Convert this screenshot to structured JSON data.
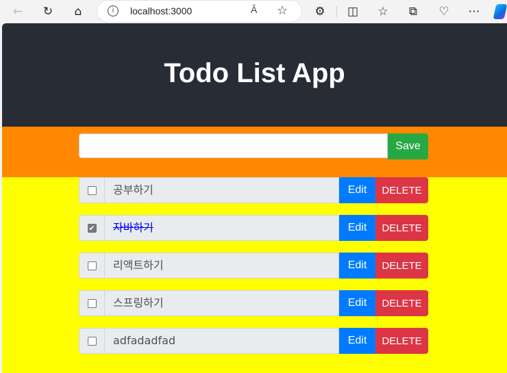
{
  "browser": {
    "url": "localhost:3000",
    "read_aloud_label": "Ȃ",
    "icons": [
      "back-icon",
      "refresh-icon",
      "home-icon",
      "info-icon",
      "read-aloud-icon",
      "favorite-star-icon",
      "extensions-icon",
      "split-screen-icon",
      "favorites-icon",
      "collections-icon",
      "browser-essentials-icon",
      "more-icon",
      "copilot-icon"
    ]
  },
  "app": {
    "title": "Todo List App",
    "input_value": "",
    "save_label": "Save",
    "edit_label": "Edit",
    "delete_label": "DELETE"
  },
  "todos": [
    {
      "text": "공부하기",
      "completed": false
    },
    {
      "text": "자바하기",
      "completed": true
    },
    {
      "text": "리액트하기",
      "completed": false
    },
    {
      "text": "스프링하기",
      "completed": false
    },
    {
      "text": "adfadadfad",
      "completed": false
    }
  ],
  "colors": {
    "header_bg": "#282c34",
    "form_bg": "#ff8800",
    "list_bg": "#ffff00",
    "save": "#28a745",
    "edit": "#007bff",
    "delete": "#dc3545",
    "completed_text": "#0000ff"
  }
}
